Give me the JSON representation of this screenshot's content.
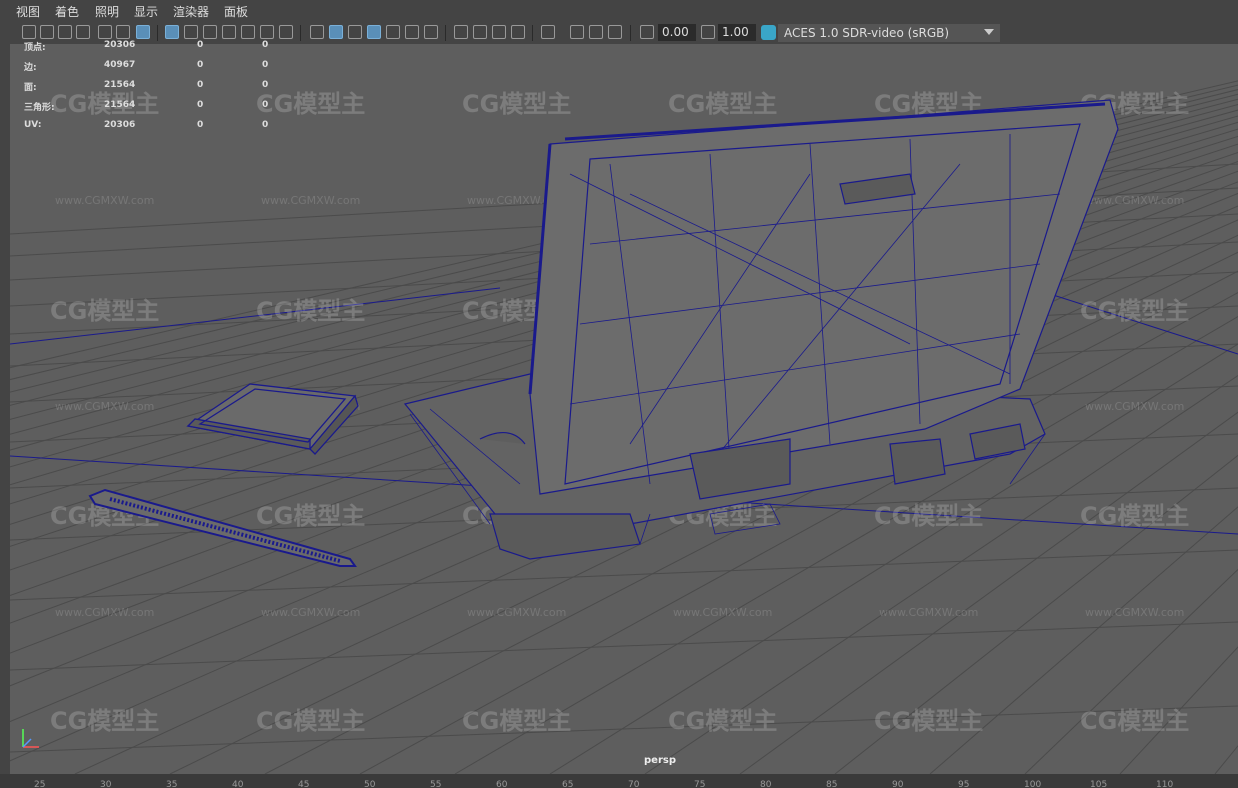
{
  "menu": [
    "视图",
    "着色",
    "照明",
    "显示",
    "渲染器",
    "面板"
  ],
  "toolbar": {
    "exposure": "0.00",
    "gamma": "1.00",
    "color_space": "ACES 1.0 SDR-video (sRGB)"
  },
  "hud": {
    "rows": [
      {
        "label": "顶点:",
        "v1": "20306",
        "v2": "0",
        "v3": "0"
      },
      {
        "label": "边:",
        "v1": "40967",
        "v2": "0",
        "v3": "0"
      },
      {
        "label": "面:",
        "v1": "21564",
        "v2": "0",
        "v3": "0"
      },
      {
        "label": "三角形:",
        "v1": "21564",
        "v2": "0",
        "v3": "0"
      },
      {
        "label": "UV:",
        "v1": "20306",
        "v2": "0",
        "v3": "0"
      }
    ]
  },
  "camera": "persp",
  "watermark": {
    "logo": "CG模型主",
    "url": "www.CGMXW.com"
  },
  "ruler": [
    "25",
    "30",
    "35",
    "40",
    "45",
    "50",
    "55",
    "60",
    "65",
    "70",
    "75",
    "80",
    "85",
    "90",
    "95",
    "100",
    "105",
    "110"
  ],
  "colors": {
    "wire": "#1a1a8c",
    "grid": "#4a4a4a",
    "viewport": "#5e5e5e"
  }
}
